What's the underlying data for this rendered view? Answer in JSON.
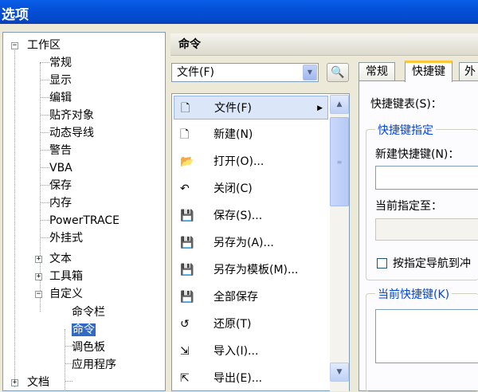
{
  "window": {
    "title": "选项"
  },
  "tree": {
    "items": [
      {
        "label": "工作区",
        "expander": "−"
      },
      {
        "label": "常规"
      },
      {
        "label": "显示"
      },
      {
        "label": "编辑"
      },
      {
        "label": "贴齐对象"
      },
      {
        "label": "动态导线"
      },
      {
        "label": "警告"
      },
      {
        "label": "VBA"
      },
      {
        "label": "保存"
      },
      {
        "label": "内存"
      },
      {
        "label": "PowerTRACE"
      },
      {
        "label": "外挂式"
      },
      {
        "label": "文本",
        "expander": "+"
      },
      {
        "label": "工具箱",
        "expander": "+"
      },
      {
        "label": "自定义",
        "expander": "−"
      },
      {
        "label": "命令栏"
      },
      {
        "label": "命令",
        "selected": true
      },
      {
        "label": "调色板"
      },
      {
        "label": "应用程序"
      },
      {
        "label": "文档",
        "expander": "+"
      }
    ]
  },
  "commands": {
    "header": "命令",
    "category_value": "文件(F)",
    "items": [
      {
        "label": "文件(F)",
        "icon": "new-doc-icon",
        "glyph": "🗋"
      },
      {
        "label": "新建(N)",
        "icon": "new-doc-icon",
        "glyph": "🗋"
      },
      {
        "label": "打开(O)...",
        "icon": "folder-open-icon",
        "glyph": "📂"
      },
      {
        "label": "关闭(C)",
        "icon": "close-doc-icon",
        "glyph": "↶"
      },
      {
        "label": "保存(S)...",
        "icon": "floppy-icon",
        "glyph": "💾"
      },
      {
        "label": "另存为(A)...",
        "icon": "save-as-icon",
        "glyph": "💾"
      },
      {
        "label": "另存为模板(M)...",
        "icon": "save-template-icon",
        "glyph": "💾"
      },
      {
        "label": "全部保存",
        "icon": "save-all-icon",
        "glyph": "💾"
      },
      {
        "label": "还原(T)",
        "icon": "revert-icon",
        "glyph": "↺"
      },
      {
        "label": "导入(I)...",
        "icon": "import-icon",
        "glyph": "⇲"
      },
      {
        "label": "导出(E)...",
        "icon": "export-icon",
        "glyph": "⇱"
      }
    ],
    "submenu_arrow": "▶"
  },
  "tabs": {
    "items": [
      "常规",
      "快捷键",
      "外"
    ],
    "active_index": 1
  },
  "shortcut_panel": {
    "table_label": "快捷键表(S)：",
    "assign_group_title": "快捷键指定",
    "new_shortcut_label": "新建快捷键(N)：",
    "current_assign_label": "当前指定至：",
    "navigate_checkbox_label": "按指定导航到冲",
    "current_shortcuts_title": "当前快捷键(K)"
  },
  "colors": {
    "titlebar": "#0450d8",
    "selection": "#316ac5",
    "group_title": "#0046d5",
    "tab_highlight": "#ffc83c"
  }
}
